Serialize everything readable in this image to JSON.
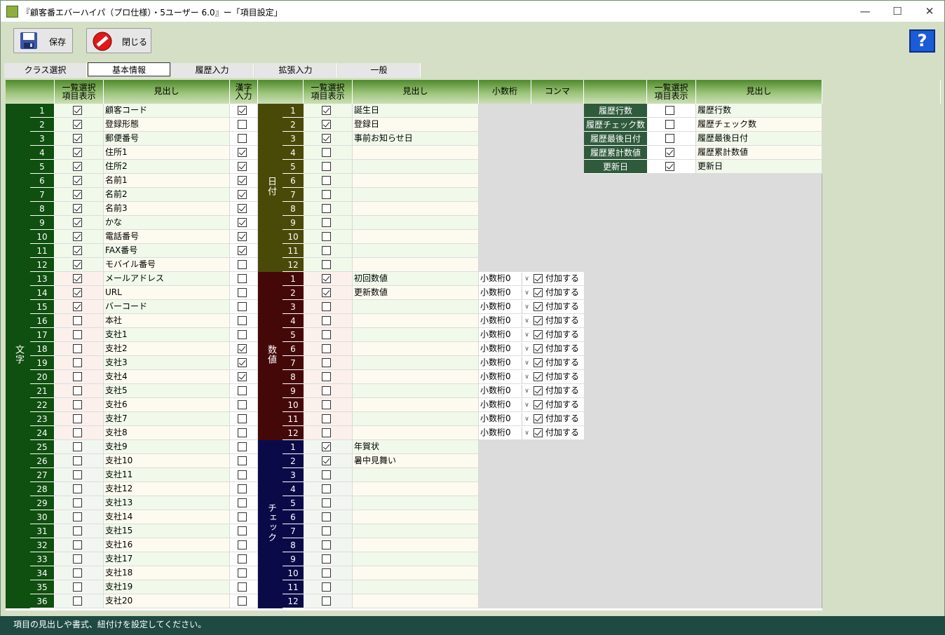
{
  "window": {
    "title": "『顧客番エバーハイパ（プロ仕様）・5ユーザー 6.0』ー「項目設定」",
    "minimize_glyph": "—",
    "maximize_glyph": "☐",
    "close_glyph": "✕"
  },
  "toolbar": {
    "save_label": "保存",
    "close_label": "閉じる",
    "help_glyph": "?"
  },
  "tabs": [
    {
      "label": "クラス選択"
    },
    {
      "label": "基本情報",
      "active": true
    },
    {
      "label": "履歴入力"
    },
    {
      "label": "拡張入力"
    },
    {
      "label": "一般"
    }
  ],
  "headers": {
    "list_display": "一覧選択\n項目表示",
    "caption": "見出し",
    "kanji": "漢字\n入力",
    "decimals": "小数桁",
    "comma": "コンマ"
  },
  "text_group": {
    "label": "文字",
    "rows": [
      {
        "n": "1",
        "chk": true,
        "caption": "顧客コード",
        "kanji": true
      },
      {
        "n": "2",
        "chk": true,
        "caption": "登録形態",
        "kanji": false
      },
      {
        "n": "3",
        "chk": true,
        "caption": "郵便番号",
        "kanji": false
      },
      {
        "n": "4",
        "chk": true,
        "caption": "住所1",
        "kanji": true
      },
      {
        "n": "5",
        "chk": true,
        "caption": "住所2",
        "kanji": true
      },
      {
        "n": "6",
        "chk": true,
        "caption": "名前1",
        "kanji": true
      },
      {
        "n": "7",
        "chk": true,
        "caption": "名前2",
        "kanji": true
      },
      {
        "n": "8",
        "chk": true,
        "caption": "名前3",
        "kanji": true
      },
      {
        "n": "9",
        "chk": true,
        "caption": "かな",
        "kanji": true
      },
      {
        "n": "10",
        "chk": true,
        "caption": "電話番号",
        "kanji": true
      },
      {
        "n": "11",
        "chk": true,
        "caption": "FAX番号",
        "kanji": true
      },
      {
        "n": "12",
        "chk": true,
        "caption": "モバイル番号",
        "kanji": false
      },
      {
        "n": "13",
        "chk": true,
        "caption": "メールアドレス",
        "kanji": false
      },
      {
        "n": "14",
        "chk": true,
        "caption": "URL",
        "kanji": false
      },
      {
        "n": "15",
        "chk": true,
        "caption": "バーコード",
        "kanji": false
      },
      {
        "n": "16",
        "chk": false,
        "caption": "本社",
        "kanji": false
      },
      {
        "n": "17",
        "chk": false,
        "caption": "支社1",
        "kanji": false
      },
      {
        "n": "18",
        "chk": false,
        "caption": "支社2",
        "kanji": true
      },
      {
        "n": "19",
        "chk": false,
        "caption": "支社3",
        "kanji": true
      },
      {
        "n": "20",
        "chk": false,
        "caption": "支社4",
        "kanji": true
      },
      {
        "n": "21",
        "chk": false,
        "caption": "支社5",
        "kanji": false
      },
      {
        "n": "22",
        "chk": false,
        "caption": "支社6",
        "kanji": false
      },
      {
        "n": "23",
        "chk": false,
        "caption": "支社7",
        "kanji": false
      },
      {
        "n": "24",
        "chk": false,
        "caption": "支社8",
        "kanji": false
      },
      {
        "n": "25",
        "chk": false,
        "caption": "支社9",
        "kanji": false
      },
      {
        "n": "26",
        "chk": false,
        "caption": "支社10",
        "kanji": false
      },
      {
        "n": "27",
        "chk": false,
        "caption": "支社11",
        "kanji": false
      },
      {
        "n": "28",
        "chk": false,
        "caption": "支社12",
        "kanji": false
      },
      {
        "n": "29",
        "chk": false,
        "caption": "支社13",
        "kanji": false
      },
      {
        "n": "30",
        "chk": false,
        "caption": "支社14",
        "kanji": false
      },
      {
        "n": "31",
        "chk": false,
        "caption": "支社15",
        "kanji": false
      },
      {
        "n": "32",
        "chk": false,
        "caption": "支社16",
        "kanji": false
      },
      {
        "n": "33",
        "chk": false,
        "caption": "支社17",
        "kanji": false
      },
      {
        "n": "34",
        "chk": false,
        "caption": "支社18",
        "kanji": false
      },
      {
        "n": "35",
        "chk": false,
        "caption": "支社19",
        "kanji": false
      },
      {
        "n": "36",
        "chk": false,
        "caption": "支社20",
        "kanji": false
      }
    ]
  },
  "date_group": {
    "label": "日付",
    "rows": [
      {
        "n": "1",
        "chk": true,
        "caption": "誕生日"
      },
      {
        "n": "2",
        "chk": true,
        "caption": "登録日"
      },
      {
        "n": "3",
        "chk": true,
        "caption": "事前お知らせ日"
      },
      {
        "n": "4",
        "chk": false,
        "caption": ""
      },
      {
        "n": "5",
        "chk": false,
        "caption": ""
      },
      {
        "n": "6",
        "chk": false,
        "caption": ""
      },
      {
        "n": "7",
        "chk": false,
        "caption": ""
      },
      {
        "n": "8",
        "chk": false,
        "caption": ""
      },
      {
        "n": "9",
        "chk": false,
        "caption": ""
      },
      {
        "n": "10",
        "chk": false,
        "caption": ""
      },
      {
        "n": "11",
        "chk": false,
        "caption": ""
      },
      {
        "n": "12",
        "chk": false,
        "caption": ""
      }
    ]
  },
  "number_group": {
    "label": "数値",
    "decimal_value": "小数桁0",
    "comma_label": "付加する",
    "rows": [
      {
        "n": "1",
        "chk": true,
        "caption": "初回数値"
      },
      {
        "n": "2",
        "chk": true,
        "caption": "更新数値"
      },
      {
        "n": "3",
        "chk": false,
        "caption": ""
      },
      {
        "n": "4",
        "chk": false,
        "caption": ""
      },
      {
        "n": "5",
        "chk": false,
        "caption": ""
      },
      {
        "n": "6",
        "chk": false,
        "caption": ""
      },
      {
        "n": "7",
        "chk": false,
        "caption": ""
      },
      {
        "n": "8",
        "chk": false,
        "caption": ""
      },
      {
        "n": "9",
        "chk": false,
        "caption": ""
      },
      {
        "n": "10",
        "chk": false,
        "caption": ""
      },
      {
        "n": "11",
        "chk": false,
        "caption": ""
      },
      {
        "n": "12",
        "chk": false,
        "caption": ""
      }
    ]
  },
  "check_group": {
    "label": "チェック",
    "rows": [
      {
        "n": "1",
        "chk": true,
        "caption": "年賀状"
      },
      {
        "n": "2",
        "chk": true,
        "caption": "暑中見舞い"
      },
      {
        "n": "3",
        "chk": false,
        "caption": ""
      },
      {
        "n": "4",
        "chk": false,
        "caption": ""
      },
      {
        "n": "5",
        "chk": false,
        "caption": ""
      },
      {
        "n": "6",
        "chk": false,
        "caption": ""
      },
      {
        "n": "7",
        "chk": false,
        "caption": ""
      },
      {
        "n": "8",
        "chk": false,
        "caption": ""
      },
      {
        "n": "9",
        "chk": false,
        "caption": ""
      },
      {
        "n": "10",
        "chk": false,
        "caption": ""
      },
      {
        "n": "11",
        "chk": false,
        "caption": ""
      },
      {
        "n": "12",
        "chk": false,
        "caption": ""
      }
    ]
  },
  "history_group": {
    "rows": [
      {
        "label": "履歴行数",
        "chk": false,
        "caption": "履歴行数"
      },
      {
        "label": "履歴チェック数",
        "chk": false,
        "caption": "履歴チェック数"
      },
      {
        "label": "履歴最後日付",
        "chk": false,
        "caption": "履歴最後日付"
      },
      {
        "label": "履歴累計数値",
        "chk": true,
        "caption": "履歴累計数値"
      },
      {
        "label": "更新日",
        "chk": true,
        "caption": "更新日"
      }
    ]
  },
  "status": {
    "message": "項目の見出しや書式、紐付けを設定してください。"
  },
  "colors": {
    "text_group": "#0f4f0f",
    "date_group": "#4a4a08",
    "number_group": "#450808",
    "check_group": "#0a0a48",
    "history_label": "#2f5a3c",
    "status_bar": "#1f4a42"
  }
}
